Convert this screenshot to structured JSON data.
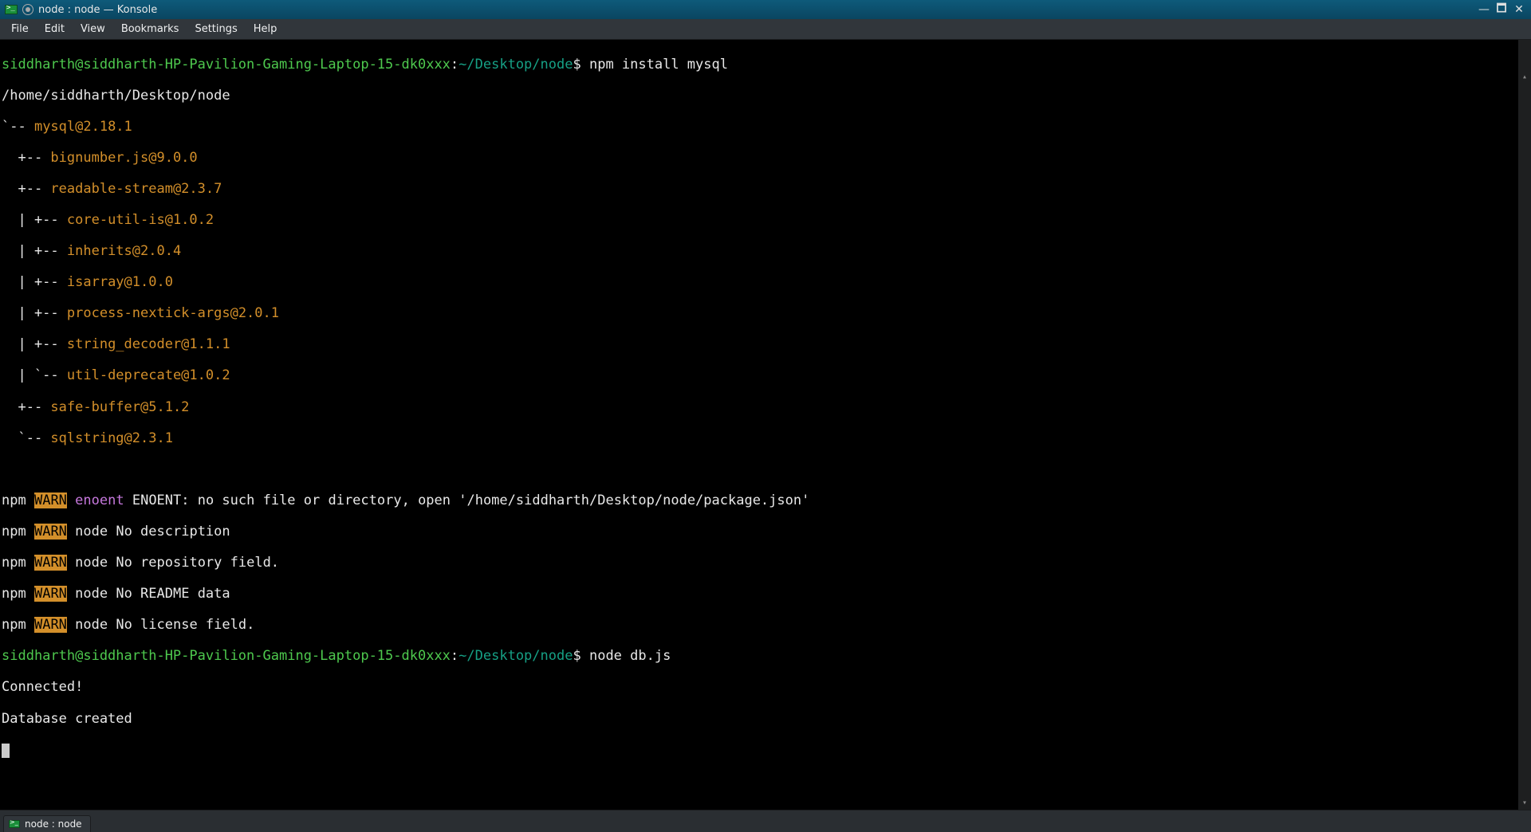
{
  "window": {
    "title": "node : node — Konsole"
  },
  "menu": {
    "items": [
      "File",
      "Edit",
      "View",
      "Bookmarks",
      "Settings",
      "Help"
    ]
  },
  "prompt": {
    "user_host": "siddharth@siddharth-HP-Pavilion-Gaming-Laptop-15-dk0xxx",
    "separator": ":",
    "path": "~/Desktop/node",
    "symbol": "$"
  },
  "commands": {
    "cmd1": "npm install mysql",
    "cmd2": "node db.js"
  },
  "tree": {
    "root_path": "/home/siddharth/Desktop/node",
    "l0": "`-- ",
    "p0": "mysql@2.18.1",
    "l1": "  +-- ",
    "p1": "bignumber.js@9.0.0",
    "l2": "  +-- ",
    "p2": "readable-stream@2.3.7",
    "l3": "  | +-- ",
    "p3": "core-util-is@1.0.2",
    "l4": "  | +-- ",
    "p4": "inherits@2.0.4",
    "l5": "  | +-- ",
    "p5": "isarray@1.0.0",
    "l6": "  | +-- ",
    "p6": "process-nextick-args@2.0.1",
    "l7": "  | +-- ",
    "p7": "string_decoder@1.1.1",
    "l8": "  | `-- ",
    "p8": "util-deprecate@1.0.2",
    "l9": "  +-- ",
    "p9": "safe-buffer@5.1.2",
    "l10": "  `-- ",
    "p10": "sqlstring@2.3.1"
  },
  "warn": {
    "npm": "npm",
    "warn": "WARN",
    "enoent": "enoent",
    "msg_enoent": "ENOENT: no such file or directory, open '/home/siddharth/Desktop/node/package.json'",
    "msg_desc": "node No description",
    "msg_repo": "node No repository field.",
    "msg_readme": "node No README data",
    "msg_lic": "node No license field."
  },
  "output": {
    "connected": "Connected!",
    "created": "Database created"
  },
  "tab": {
    "label": "node : node"
  },
  "glyph": {
    "min": "—",
    "max": "🗖",
    "close": "✕",
    "up": "▴",
    "down": "▾"
  }
}
